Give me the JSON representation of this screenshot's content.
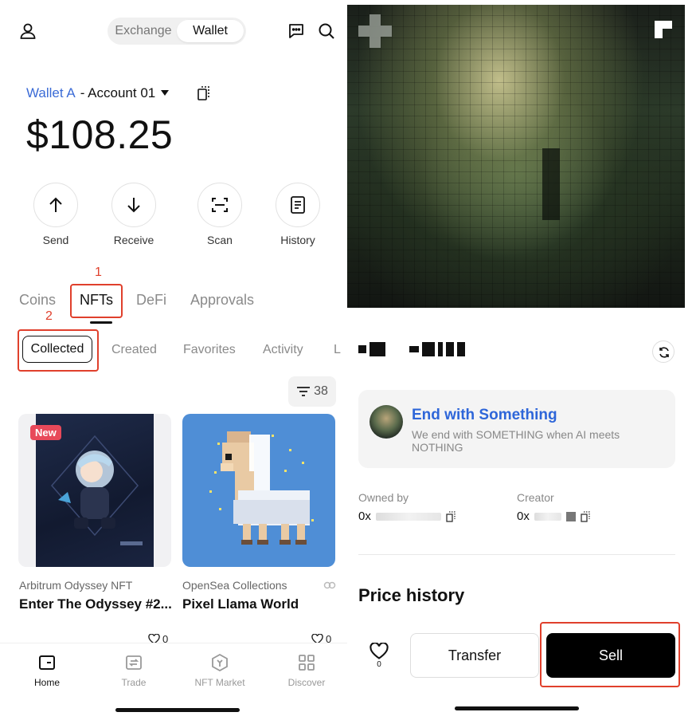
{
  "header": {
    "segments": [
      "Exchange",
      "Wallet"
    ],
    "active_segment": "Wallet"
  },
  "account": {
    "wallet_name": "Wallet A",
    "account_name": "- Account 01"
  },
  "balance": "$108.25",
  "actions": [
    {
      "label": "Send",
      "icon": "arrow-up-icon"
    },
    {
      "label": "Receive",
      "icon": "arrow-down-icon"
    },
    {
      "label": "Scan",
      "icon": "scan-icon"
    },
    {
      "label": "History",
      "icon": "history-icon"
    }
  ],
  "asset_tabs": [
    "Coins",
    "NFTs",
    "DeFi",
    "Approvals"
  ],
  "active_asset_tab": "NFTs",
  "annotations": {
    "one": "1",
    "two": "2",
    "accent": "#e0402c"
  },
  "nft_filters": [
    "Collected",
    "Created",
    "Favorites",
    "Activity",
    "L"
  ],
  "nft_count": "38",
  "cards": [
    {
      "collection": "Arbitrum Odyssey NFT",
      "title": "Enter The Odyssey #2...",
      "likes": "0",
      "badge": "New"
    },
    {
      "collection": "OpenSea Collections",
      "title": "Pixel Llama World",
      "likes": "0"
    }
  ],
  "bottom_nav": [
    {
      "label": "Home",
      "icon": "home-icon",
      "active": true
    },
    {
      "label": "Trade",
      "icon": "trade-icon"
    },
    {
      "label": "NFT Market",
      "icon": "nft-market-icon"
    },
    {
      "label": "Discover",
      "icon": "discover-icon"
    }
  ],
  "detail": {
    "collection_name": "End with Something",
    "collection_desc": "We end with SOMETHING when AI meets NOTHING",
    "owned_by_label": "Owned by",
    "owned_by_value": "0x",
    "creator_label": "Creator",
    "creator_value": "0x",
    "price_history": "Price history",
    "like_count": "0",
    "transfer_label": "Transfer",
    "sell_label": "Sell"
  },
  "colors": {
    "link_blue": "#3b6bd6",
    "collection_blue": "#2e66d9",
    "new_badge": "#e8495a",
    "sell_bg": "#000000"
  }
}
